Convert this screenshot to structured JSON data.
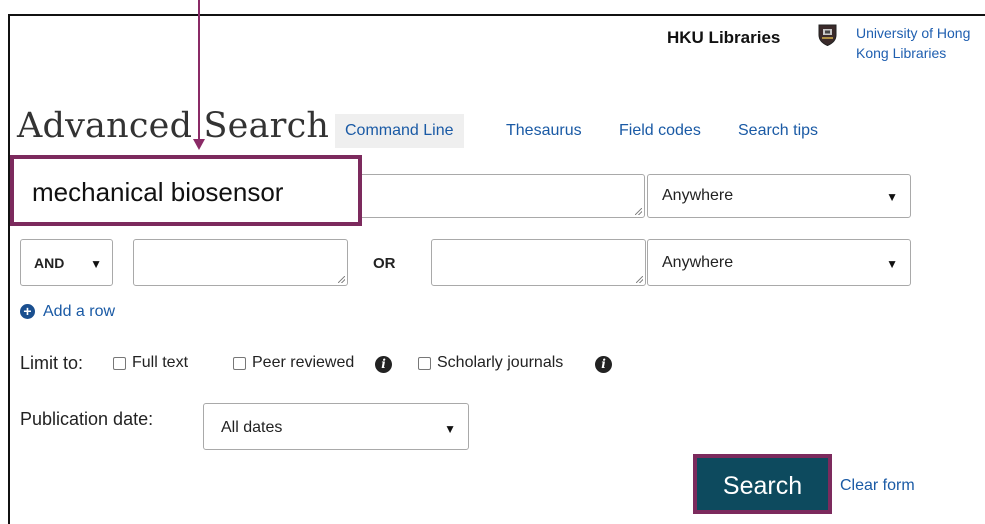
{
  "header": {
    "brand": "HKU Libraries",
    "link_line1": "University of Hong",
    "link_line2": "Kong Libraries"
  },
  "page_title": "Advanced Search",
  "nav": {
    "command_line": "Command Line",
    "thesaurus": "Thesaurus",
    "field_codes": "Field codes",
    "search_tips": "Search tips"
  },
  "row1": {
    "query_value": "mechanical biosensor",
    "field_select": "Anywhere"
  },
  "row2": {
    "operator": "AND",
    "between_label": "OR",
    "field_select": "Anywhere"
  },
  "add_row": "Add a row",
  "limit": {
    "label": "Limit to:",
    "options": [
      "Full text",
      "Peer reviewed",
      "Scholarly journals"
    ]
  },
  "publication": {
    "label": "Publication date:",
    "value": "All dates"
  },
  "actions": {
    "search": "Search",
    "clear": "Clear form"
  },
  "colors": {
    "highlight": "#7c2a5d",
    "link": "#1a5aa5",
    "search_button": "#0d4a5e"
  }
}
